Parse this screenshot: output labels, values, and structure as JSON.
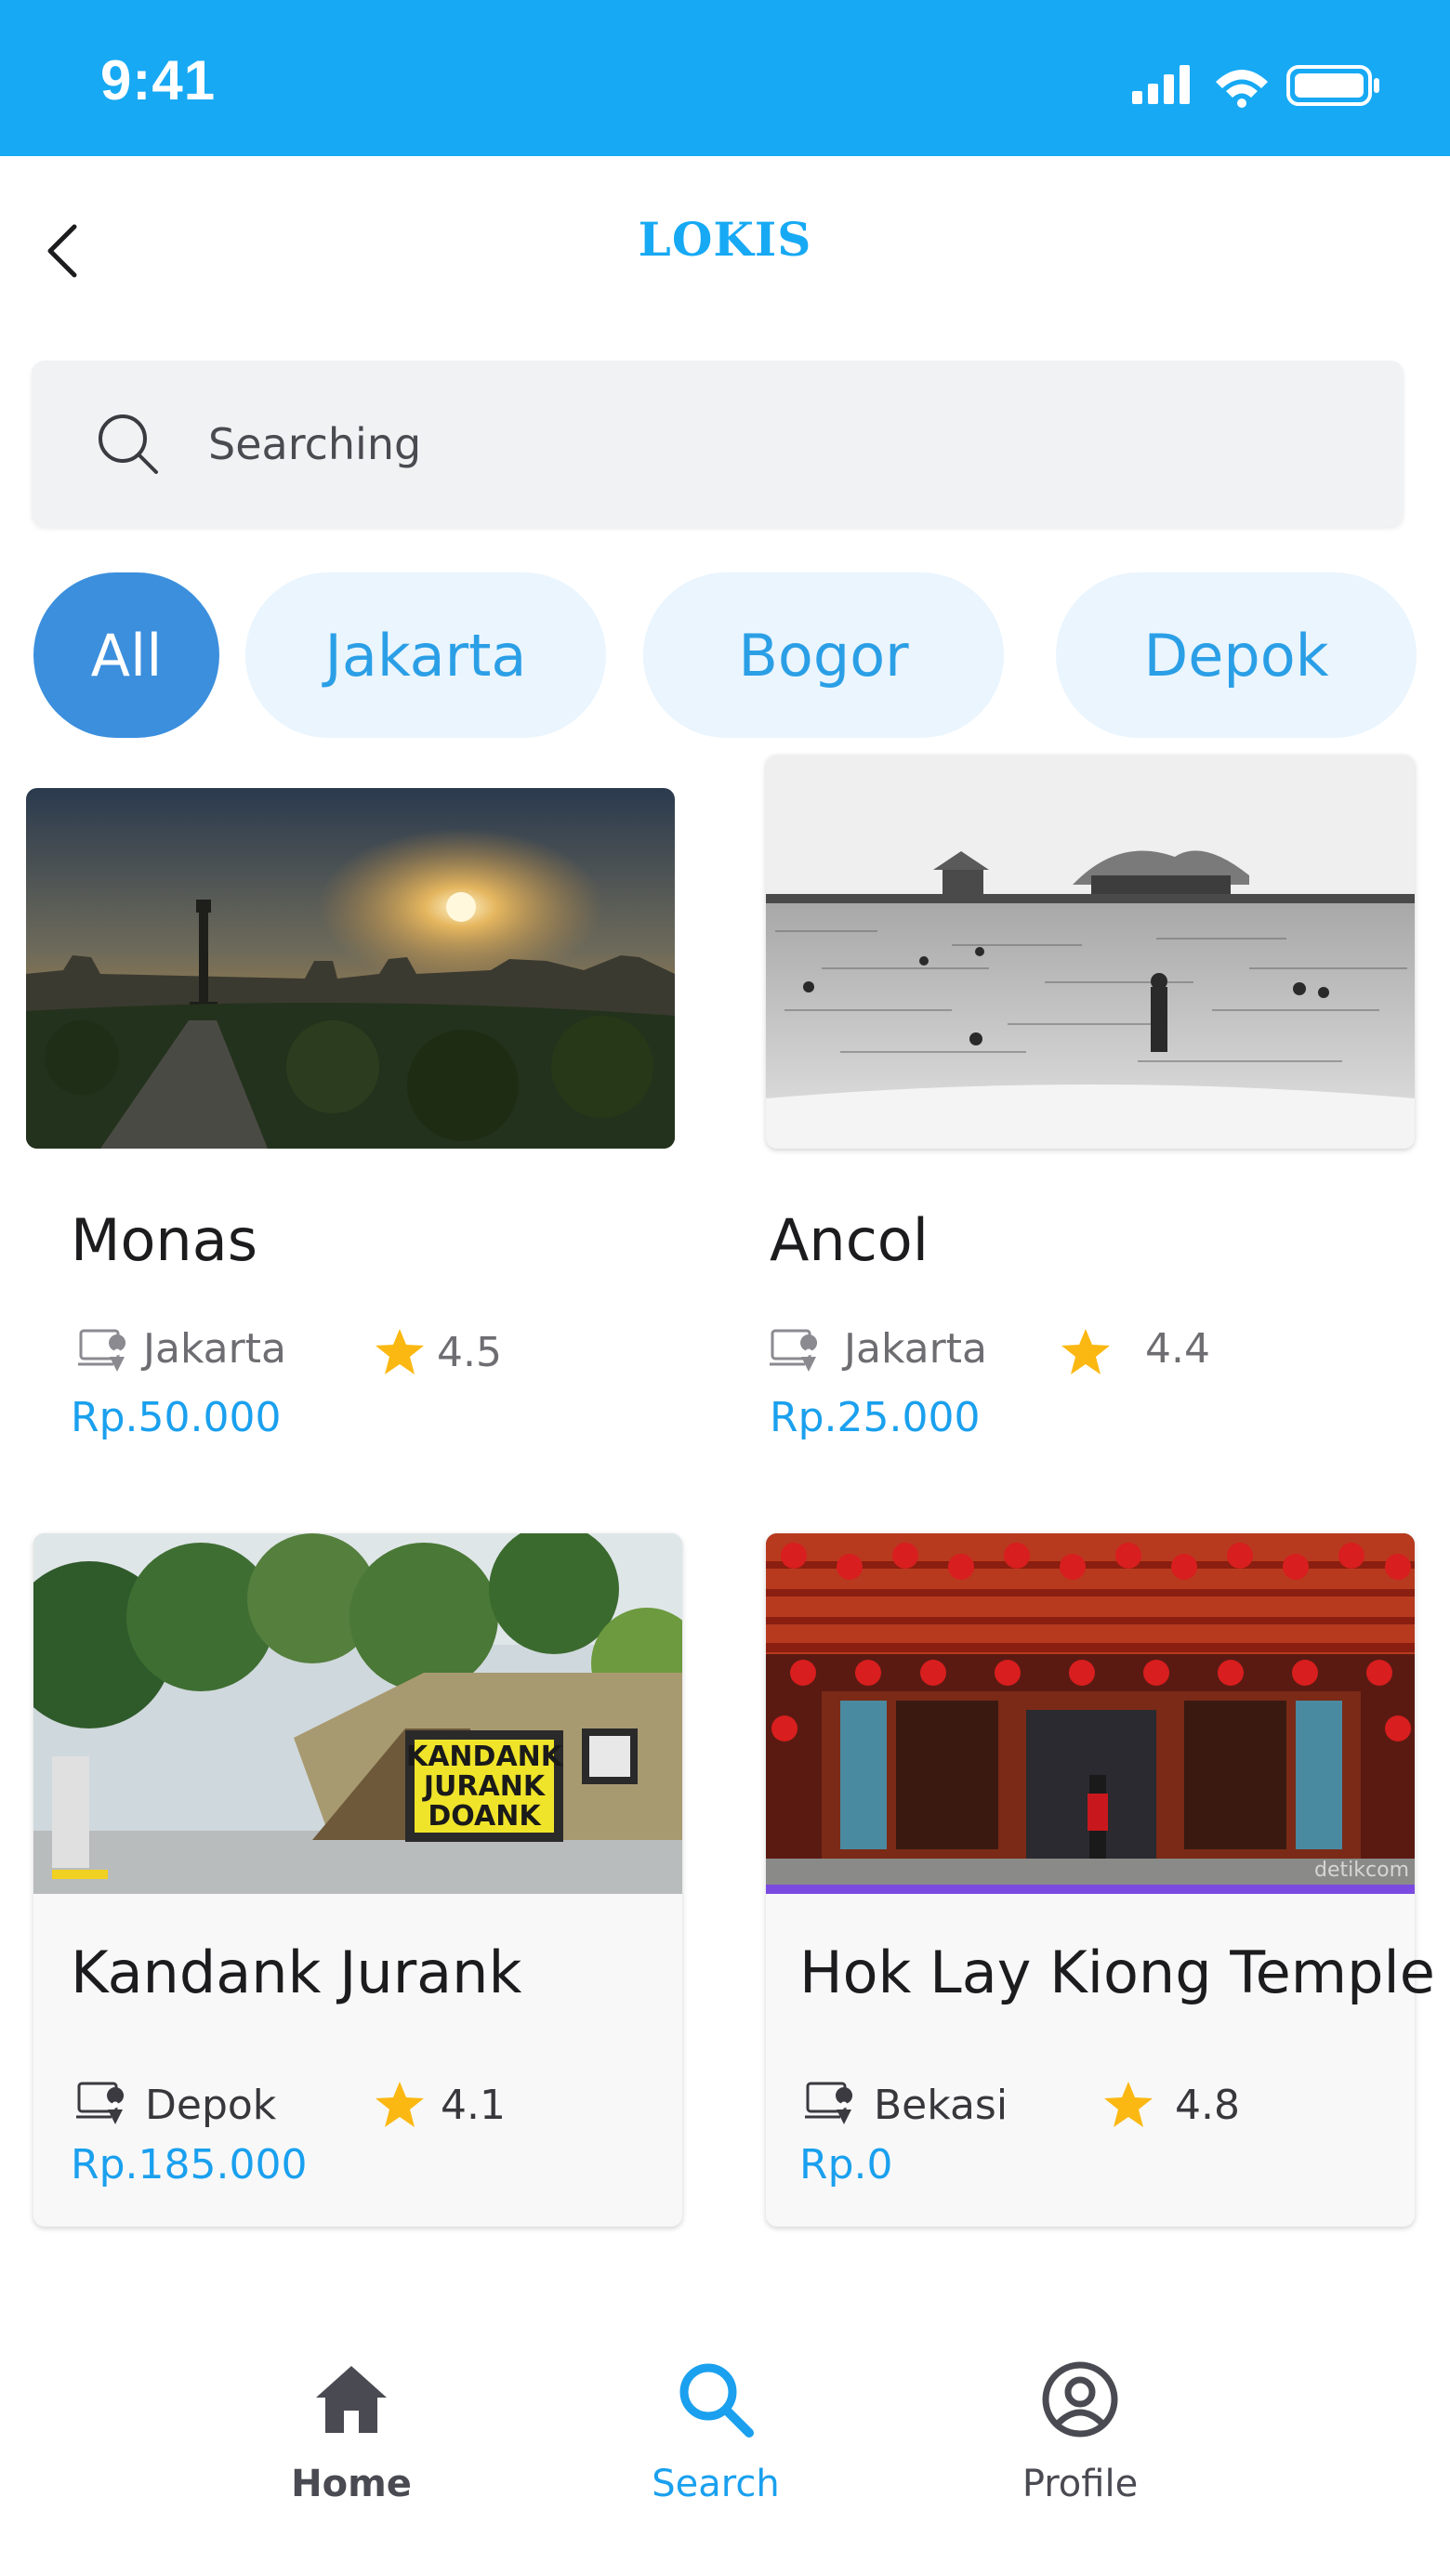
{
  "status_bar": {
    "time": "9:41"
  },
  "header": {
    "title": "LOKIS"
  },
  "search": {
    "placeholder": "Searching"
  },
  "filters": [
    {
      "label": "All",
      "active": true
    },
    {
      "label": "Jakarta",
      "active": false
    },
    {
      "label": "Bogor",
      "active": false
    },
    {
      "label": "Depok",
      "active": false
    }
  ],
  "places": [
    {
      "name": "Monas",
      "location": "Jakarta",
      "rating": "4.5",
      "price": "Rp.50.000",
      "image": "monas-photo"
    },
    {
      "name": "Ancol",
      "location": "Jakarta",
      "rating": "4.4",
      "price": "Rp.25.000",
      "image": "ancol-photo"
    },
    {
      "name": "Kandank Jurank",
      "location": "Depok",
      "rating": "4.1",
      "price": "Rp.185.000",
      "image": "kandank-jurank-photo",
      "sign_text": [
        "KANDANK",
        "JURANK",
        "DOANK"
      ]
    },
    {
      "name": "Hok Lay Kiong Temple",
      "location": "Bekasi",
      "rating": "4.8",
      "price": "Rp.0",
      "image": "temple-photo",
      "watermark": "detikcom"
    }
  ],
  "bottom_nav": [
    {
      "label": "Home",
      "icon": "home-icon",
      "active": false
    },
    {
      "label": "Search",
      "icon": "search-icon",
      "active": true
    },
    {
      "label": "Profile",
      "icon": "profile-icon",
      "active": false
    }
  ],
  "colors": {
    "brand": "#17a9f4",
    "chip_active": "#3b8fdd",
    "chip_bg": "#eaf5fe",
    "price": "#1aa0ee",
    "star": "#fbb812",
    "nav_active": "#1aa0ee",
    "nav_inactive": "#4a4a52"
  }
}
